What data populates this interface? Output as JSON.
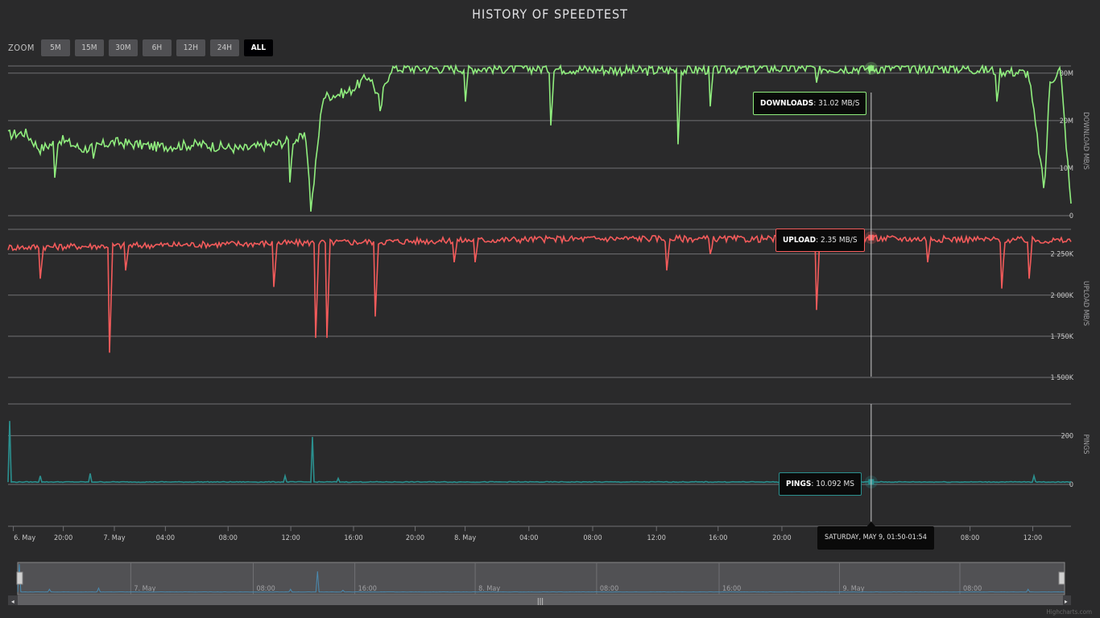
{
  "title": "HISTORY OF SPEEDTEST",
  "zoom": {
    "label": "ZOOM",
    "buttons": [
      "5M",
      "15M",
      "30M",
      "6H",
      "12H",
      "24H",
      "ALL"
    ],
    "active": "ALL"
  },
  "credits": "Highcharts.com",
  "tooltips": {
    "download": {
      "label": "DOWNLOADS",
      "value": ": 31.02 MB/S"
    },
    "upload": {
      "label": "UPLOAD",
      "value": ": 2.35 MB/S"
    },
    "ping": {
      "label": "PINGS",
      "value": ": 10.092 MS"
    },
    "time": "SATURDAY, MAY 9, 01:50-01:54"
  },
  "colors": {
    "download": "#90ee7e",
    "upload": "#f45b5b",
    "ping": "#2b908f",
    "background": "#2a2a2b",
    "navigator": "#4a8ab0"
  },
  "chart_data": {
    "type": "line",
    "x_range": [
      "2015-05-06 17:30",
      "2015-05-09 14:10"
    ],
    "xaxis_ticks": [
      "6. May",
      "20:00",
      "7. May",
      "04:00",
      "08:00",
      "12:00",
      "16:00",
      "20:00",
      "8. May",
      "04:00",
      "08:00",
      "12:00",
      "16:00",
      "20:00",
      "04:00",
      "08:00",
      "12:00"
    ],
    "navigator_ticks": [
      "7. May",
      "08:00",
      "16:00",
      "8. May",
      "08:00",
      "16:00",
      "9. May",
      "08:00"
    ],
    "panes": [
      {
        "name": "DOWNLOADS",
        "ylabel": "DOWNLOAD MB/S",
        "unit": "MB/S",
        "ylim": [
          0,
          31.5
        ],
        "ytick_labels": [
          "0",
          "10M",
          "20M",
          "30M"
        ],
        "keypoints": [
          [
            0,
            17
          ],
          [
            0.016,
            17.5
          ],
          [
            0.03,
            14
          ],
          [
            0.05,
            16
          ],
          [
            0.07,
            14
          ],
          [
            0.1,
            15.5
          ],
          [
            0.14,
            14.5
          ],
          [
            0.18,
            15
          ],
          [
            0.22,
            14
          ],
          [
            0.25,
            15
          ],
          [
            0.28,
            16.5
          ],
          [
            0.282,
            12
          ],
          [
            0.285,
            1
          ],
          [
            0.29,
            12
          ],
          [
            0.296,
            25
          ],
          [
            0.32,
            26
          ],
          [
            0.34,
            29.5
          ],
          [
            0.35,
            24
          ],
          [
            0.36,
            31
          ],
          [
            0.5,
            31
          ],
          [
            0.6,
            30.5
          ],
          [
            0.7,
            31
          ],
          [
            0.8,
            31
          ],
          [
            0.9,
            31
          ],
          [
            0.96,
            30
          ],
          [
            0.975,
            5
          ],
          [
            0.98,
            28
          ],
          [
            0.99,
            31
          ],
          [
            1.0,
            2
          ]
        ],
        "dips": [
          [
            0.044,
            8
          ],
          [
            0.08,
            12
          ],
          [
            0.265,
            7
          ],
          [
            0.35,
            22
          ],
          [
            0.43,
            24
          ],
          [
            0.51,
            19
          ],
          [
            0.63,
            15
          ],
          [
            0.66,
            23
          ],
          [
            0.76,
            28
          ],
          [
            0.93,
            24
          ]
        ],
        "tooltip_value": 31.02
      },
      {
        "name": "UPLOAD",
        "ylabel": "UPLOAD MB/S",
        "unit": "K",
        "ylim": [
          1500,
          2400
        ],
        "ytick_labels": [
          "1 500K",
          "1 750K",
          "2 000K",
          "2 250K"
        ],
        "keypoints": [
          [
            0,
            2290
          ],
          [
            0.1,
            2300
          ],
          [
            0.2,
            2310
          ],
          [
            0.3,
            2320
          ],
          [
            0.4,
            2330
          ],
          [
            0.5,
            2340
          ],
          [
            0.6,
            2345
          ],
          [
            0.7,
            2340
          ],
          [
            0.76,
            2350
          ],
          [
            0.8,
            2345
          ],
          [
            0.9,
            2340
          ],
          [
            1.0,
            2330
          ]
        ],
        "dips": [
          [
            0.03,
            2100
          ],
          [
            0.095,
            1650
          ],
          [
            0.11,
            2150
          ],
          [
            0.25,
            2050
          ],
          [
            0.29,
            1740
          ],
          [
            0.3,
            1740
          ],
          [
            0.345,
            1870
          ],
          [
            0.42,
            2200
          ],
          [
            0.44,
            2200
          ],
          [
            0.62,
            2150
          ],
          [
            0.66,
            2250
          ],
          [
            0.76,
            1910
          ],
          [
            0.865,
            2200
          ],
          [
            0.935,
            2040
          ],
          [
            0.96,
            2100
          ]
        ],
        "tooltip_value": 2350
      },
      {
        "name": "PINGS",
        "ylabel": "PINGS",
        "unit": "MS",
        "ylim": [
          0,
          330
        ],
        "ytick_labels": [
          "0",
          "200"
        ],
        "keypoints": [
          [
            0,
            10
          ],
          [
            1.0,
            10
          ]
        ],
        "spikes": [
          [
            0.002,
            260
          ],
          [
            0.03,
            35
          ],
          [
            0.078,
            45
          ],
          [
            0.26,
            35
          ],
          [
            0.287,
            195
          ],
          [
            0.31,
            25
          ],
          [
            0.965,
            35
          ]
        ],
        "tooltip_value": 10.092
      }
    ],
    "crosshair_position": 0.812
  }
}
